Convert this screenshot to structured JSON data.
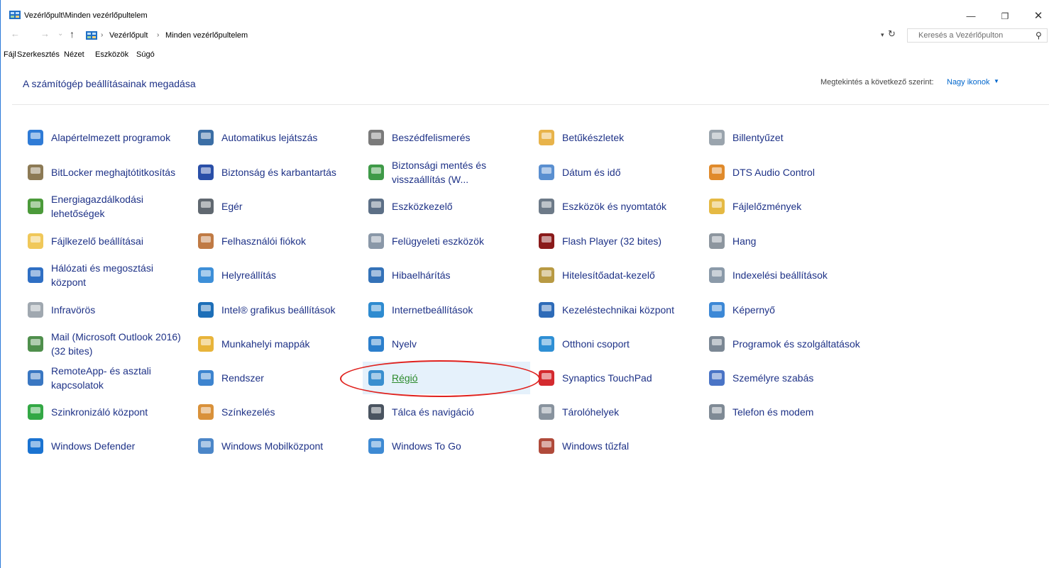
{
  "window": {
    "title": "Vezérlőpult\\Minden vezérlőpultelem",
    "controls": {
      "minimize": "—",
      "maximize": "❐",
      "close": "✕"
    }
  },
  "address": {
    "back": "←",
    "forward": "→",
    "recent": "⌄",
    "up": "↑",
    "crumbs": [
      "Vezérlőpult",
      "Minden vezérlőpultelem"
    ],
    "separator": "›"
  },
  "search": {
    "placeholder": "Keresés a Vezérlőpulton"
  },
  "menu": [
    "Fájl",
    "Szerkesztés",
    "Nézet",
    "Eszközök",
    "Súgó"
  ],
  "heading": "A számítógép beállításainak megadása",
  "view_by": {
    "label": "Megtekintés a következő szerint:",
    "value": "Nagy ikonok"
  },
  "items": [
    {
      "label": "Alapértelmezett programok",
      "icon": "default-programs-icon"
    },
    {
      "label": "Automatikus lejátszás",
      "icon": "autoplay-icon"
    },
    {
      "label": "Beszédfelismerés",
      "icon": "microphone-icon"
    },
    {
      "label": "Betűkészletek",
      "icon": "fonts-icon"
    },
    {
      "label": "Billentyűzet",
      "icon": "keyboard-icon"
    },
    {
      "label": "BitLocker meghajtótitkosítás",
      "icon": "bitlocker-icon"
    },
    {
      "label": "Biztonság és karbantartás",
      "icon": "flag-icon"
    },
    {
      "label": "Biztonsági mentés és visszaállítás (W...",
      "icon": "backup-icon"
    },
    {
      "label": "Dátum és idő",
      "icon": "calendar-clock-icon"
    },
    {
      "label": "DTS Audio Control",
      "icon": "dts-icon"
    },
    {
      "label": "Energiagazdálkodási lehetőségek",
      "icon": "power-icon"
    },
    {
      "label": "Egér",
      "icon": "mouse-icon"
    },
    {
      "label": "Eszközkezelő",
      "icon": "device-manager-icon"
    },
    {
      "label": "Eszközök és nyomtatók",
      "icon": "printer-icon"
    },
    {
      "label": "Fájlelőzmények",
      "icon": "file-history-icon"
    },
    {
      "label": "Fájlkezelő beállításai",
      "icon": "folder-options-icon"
    },
    {
      "label": "Felhasználói fiókok",
      "icon": "user-accounts-icon"
    },
    {
      "label": "Felügyeleti eszközök",
      "icon": "admin-tools-icon"
    },
    {
      "label": "Flash Player (32 bites)",
      "icon": "flash-icon"
    },
    {
      "label": "Hang",
      "icon": "speaker-icon"
    },
    {
      "label": "Hálózati és megosztási központ",
      "icon": "network-icon"
    },
    {
      "label": "Helyreállítás",
      "icon": "recovery-icon"
    },
    {
      "label": "Hibaelhárítás",
      "icon": "troubleshoot-icon"
    },
    {
      "label": "Hitelesítőadat-kezelő",
      "icon": "credential-icon"
    },
    {
      "label": "Indexelési beállítások",
      "icon": "indexing-icon"
    },
    {
      "label": "Infravörös",
      "icon": "infrared-icon"
    },
    {
      "label": "Intel® grafikus beállítások",
      "icon": "intel-graphics-icon"
    },
    {
      "label": "Internetbeállítások",
      "icon": "internet-options-icon"
    },
    {
      "label": "Kezeléstechnikai központ",
      "icon": "ease-of-access-icon"
    },
    {
      "label": "Képernyő",
      "icon": "display-icon"
    },
    {
      "label": "Mail (Microsoft Outlook 2016) (32 bites)",
      "icon": "mail-icon"
    },
    {
      "label": "Munkahelyi mappák",
      "icon": "work-folders-icon"
    },
    {
      "label": "Nyelv",
      "icon": "language-icon"
    },
    {
      "label": "Otthoni csoport",
      "icon": "homegroup-icon"
    },
    {
      "label": "Programok és szolgáltatások",
      "icon": "programs-icon"
    },
    {
      "label": "RemoteApp- és asztali kapcsolatok",
      "icon": "remoteapp-icon"
    },
    {
      "label": "Rendszer",
      "icon": "system-icon"
    },
    {
      "label": "Régió",
      "icon": "region-globe-icon"
    },
    {
      "label": "Synaptics TouchPad",
      "icon": "touchpad-icon"
    },
    {
      "label": "Személyre szabás",
      "icon": "personalization-icon"
    },
    {
      "label": "Szinkronizáló központ",
      "icon": "sync-icon"
    },
    {
      "label": "Színkezelés",
      "icon": "color-management-icon"
    },
    {
      "label": "Tálca és navigáció",
      "icon": "taskbar-icon"
    },
    {
      "label": "Tárolóhelyek",
      "icon": "storage-icon"
    },
    {
      "label": "Telefon és modem",
      "icon": "phone-icon"
    },
    {
      "label": "Windows Defender",
      "icon": "defender-shield-icon"
    },
    {
      "label": "Windows Mobilközpont",
      "icon": "mobility-center-icon"
    },
    {
      "label": "Windows To Go",
      "icon": "windows-to-go-icon"
    },
    {
      "label": "Windows tűzfal",
      "icon": "firewall-icon"
    }
  ],
  "selected_item": "Régió",
  "colors": {
    "link": "#1e3287",
    "selected": "#2b8a2b",
    "annotation": "#e0221e"
  }
}
